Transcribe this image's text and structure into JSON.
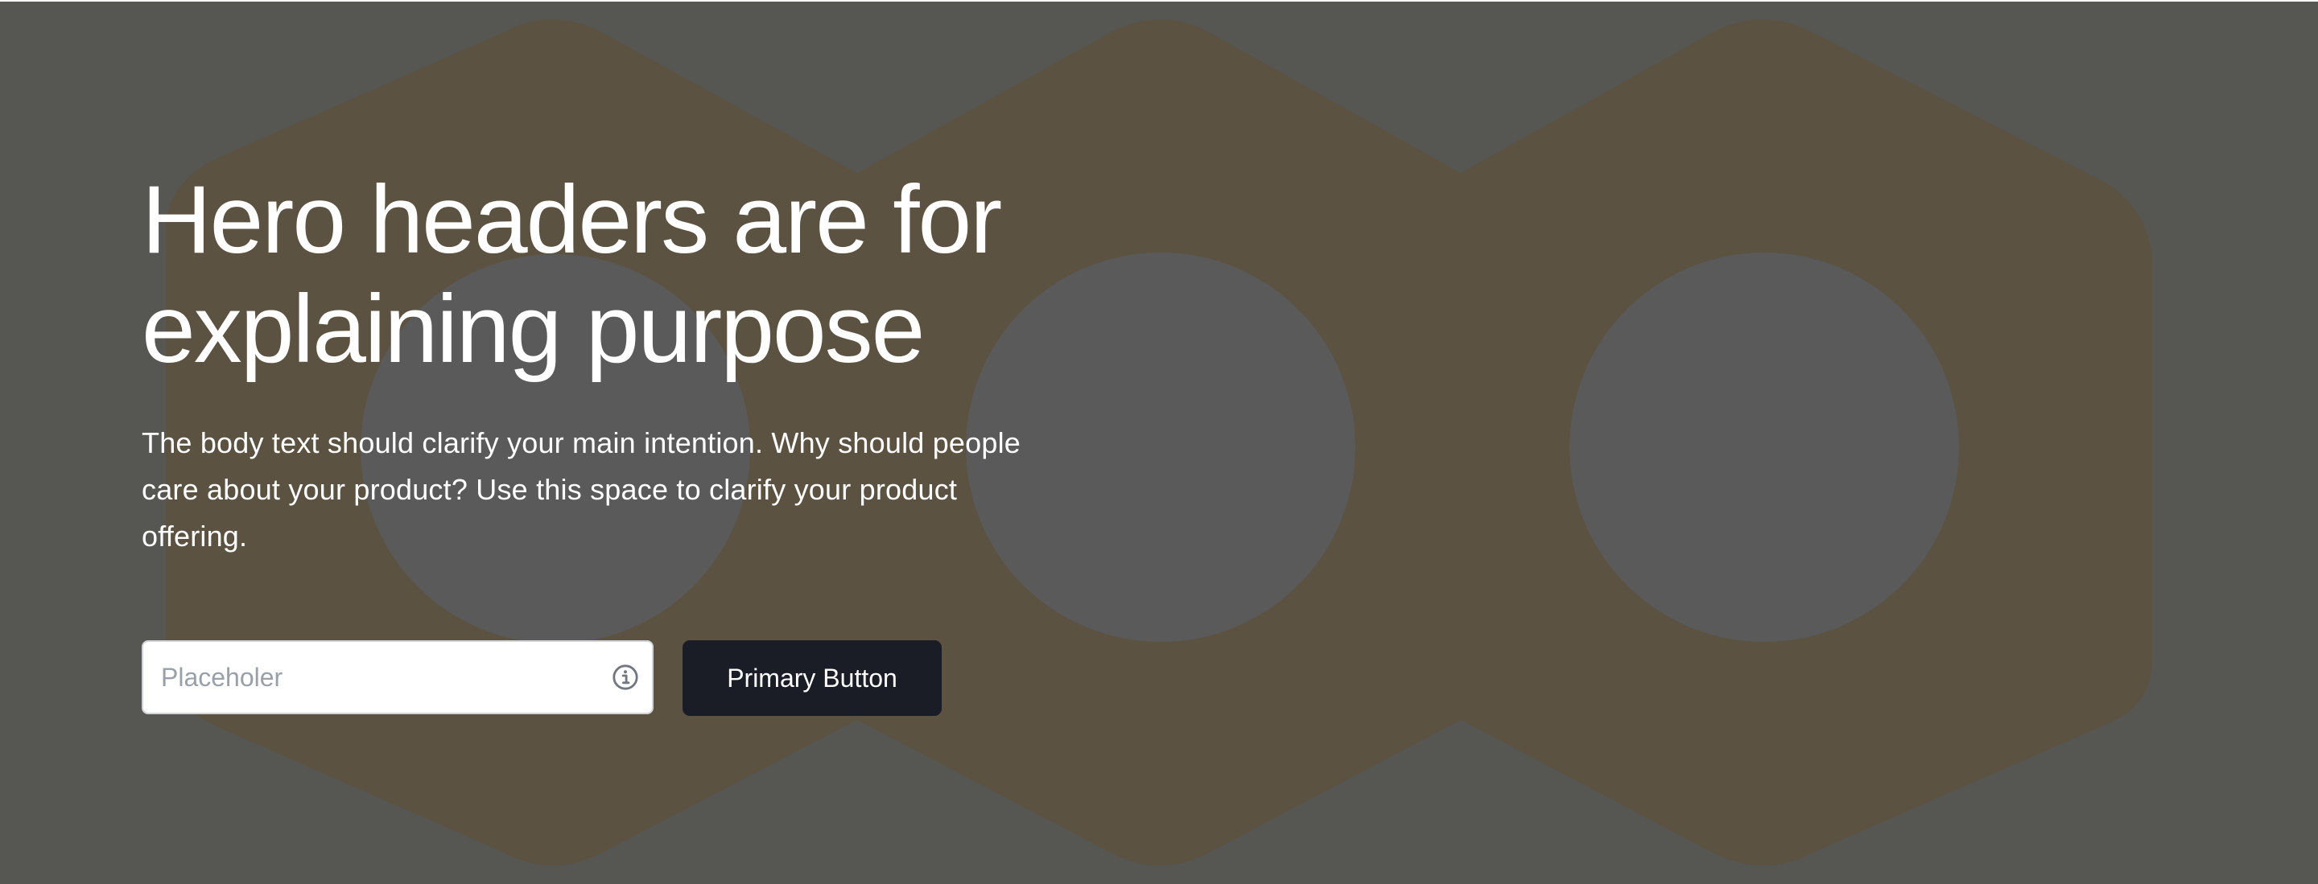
{
  "hero": {
    "title_line1": "Hero headers are for",
    "title_line2": "explaining purpose",
    "body_line1": "The body text should clarify your main intention. Why should people",
    "body_line2": "care about your product? Use this space to clarify your product",
    "body_line3": "offering."
  },
  "form": {
    "input_placeholder": "Placeholer",
    "input_value": "",
    "info_icon": "info-circle",
    "button_label": "Primary Button"
  },
  "colors": {
    "background": "#565653",
    "background_shape": "#5b5242",
    "background_circles": "#5a5a5a",
    "text": "#ffffff",
    "button_background": "#1b1d26",
    "input_background": "#ffffff",
    "input_border": "#d2d4d8",
    "placeholder": "#9aa0a8",
    "icon": "#717680"
  }
}
